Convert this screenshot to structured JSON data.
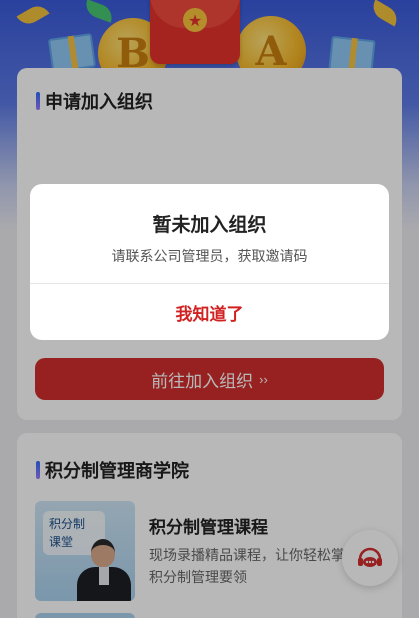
{
  "join_section": {
    "title": "申请加入组织",
    "join_button_label": "前往加入组织",
    "join_button_chevron": "››"
  },
  "academy_section": {
    "title": "积分制管理商学院",
    "course": {
      "thumbnail_badge": "积分制\n课堂",
      "title": "积分制管理课程",
      "description": "现场录播精品课程，让你轻松掌握积分制管理要领"
    }
  },
  "modal": {
    "title": "暂未加入组织",
    "message": "请联系公司管理员，获取邀请码",
    "confirm_label": "我知道了"
  },
  "banner": {
    "coin_left_letter": "B",
    "coin_right_letter": "A",
    "red_packet_icon": "★"
  },
  "support": {
    "icon": "headset-chat-icon"
  },
  "colors": {
    "accent_red": "#d12e2e",
    "banner_blue": "#3b5bdb",
    "title_bar_gradient_start": "#2e6bff"
  }
}
